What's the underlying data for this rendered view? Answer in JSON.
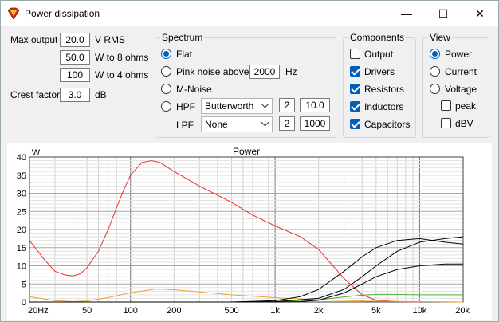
{
  "window": {
    "title": "Power dissipation",
    "buttons": {
      "minimize": "—",
      "maximize": "☐",
      "close": "✕"
    }
  },
  "levels": {
    "max_output_label": "Max output",
    "max_output_value": "20.0",
    "max_output_unit": "V  RMS",
    "w8_value": "50.0",
    "w8_unit": "W to 8 ohms",
    "w4_value": "100",
    "w4_unit": "W to 4 ohms",
    "crest_label": "Crest factor",
    "crest_value": "3.0",
    "crest_unit": "dB"
  },
  "spectrum": {
    "title": "Spectrum",
    "flat": "Flat",
    "pink": "Pink noise above",
    "pink_value": "2000",
    "pink_unit": "Hz",
    "mnoise": "M-Noise",
    "hpf": "HPF",
    "hpf_type": "Butterworth",
    "hpf_order": "2",
    "hpf_freq": "10.0",
    "lpf": "LPF",
    "lpf_type": "None",
    "lpf_order": "2",
    "lpf_freq": "1000",
    "selected": "flat"
  },
  "components": {
    "title": "Components",
    "items": [
      {
        "label": "Output",
        "checked": false
      },
      {
        "label": "Drivers",
        "checked": true
      },
      {
        "label": "Resistors",
        "checked": true
      },
      {
        "label": "Inductors",
        "checked": true
      },
      {
        "label": "Capacitors",
        "checked": true
      }
    ]
  },
  "view": {
    "title": "View",
    "power": "Power",
    "current": "Current",
    "voltage": "Voltage",
    "peak": "peak",
    "dbv": "dBV",
    "selected": "power"
  },
  "chart_data": {
    "type": "line",
    "title": "Power",
    "ylabel": "W",
    "xscale": "log",
    "xlim": [
      20,
      20000
    ],
    "ylim": [
      0,
      40
    ],
    "yticks": [
      0,
      5,
      10,
      15,
      20,
      25,
      30,
      35,
      40
    ],
    "xticks": [
      {
        "v": 20,
        "label": "20Hz"
      },
      {
        "v": 50,
        "label": "50"
      },
      {
        "v": 100,
        "label": "100"
      },
      {
        "v": 200,
        "label": "200"
      },
      {
        "v": 500,
        "label": "500"
      },
      {
        "v": 1000,
        "label": "1k"
      },
      {
        "v": 2000,
        "label": "2k"
      },
      {
        "v": 5000,
        "label": "5k"
      },
      {
        "v": 10000,
        "label": "10k"
      },
      {
        "v": 20000,
        "label": "20k"
      }
    ],
    "grid": true,
    "series": [
      {
        "color": "#e83030",
        "x": [
          20,
          25,
          30,
          35,
          40,
          45,
          50,
          60,
          70,
          80,
          90,
          100,
          120,
          140,
          160,
          200,
          300,
          500,
          700,
          1000,
          1500,
          2000,
          3000,
          4000,
          5000,
          7000,
          10000
        ],
        "y": [
          17,
          12,
          8.5,
          7.5,
          7.2,
          7.8,
          9.5,
          14,
          20,
          26,
          31,
          35,
          38.5,
          39,
          38.5,
          36,
          32,
          27.5,
          24,
          21,
          18,
          14.5,
          6.5,
          2,
          0.5,
          0.1,
          0
        ]
      },
      {
        "color": "#f0a030",
        "x": [
          20,
          30,
          40,
          50,
          70,
          100,
          150,
          200,
          300,
          500,
          1000,
          2000,
          5000,
          10000,
          20000
        ],
        "y": [
          1.5,
          0.4,
          0.1,
          0.3,
          1.2,
          2.6,
          3.6,
          3.4,
          2.8,
          2.0,
          1.2,
          0.6,
          0.2,
          0.1,
          0
        ]
      },
      {
        "color": "#50b030",
        "x": [
          20,
          500,
          1000,
          2000,
          3000,
          4000,
          5000,
          7000,
          10000,
          20000
        ],
        "y": [
          0,
          0,
          0.1,
          0.6,
          1.4,
          1.9,
          2.1,
          2.1,
          2.0,
          2.0
        ]
      },
      {
        "color": "#000000",
        "x": [
          20,
          500,
          1000,
          1500,
          2000,
          3000,
          4000,
          5000,
          7000,
          10000,
          15000,
          20000
        ],
        "y": [
          0,
          0,
          0.4,
          1.5,
          3.5,
          8.5,
          12.5,
          15,
          17,
          17.5,
          16.5,
          16
        ]
      },
      {
        "color": "#000000",
        "x": [
          20,
          500,
          1000,
          2000,
          3000,
          4000,
          5000,
          7000,
          10000,
          15000,
          20000
        ],
        "y": [
          0,
          0,
          0.1,
          1.0,
          3.5,
          7,
          10,
          14,
          16.5,
          17.5,
          18
        ]
      },
      {
        "color": "#000000",
        "x": [
          20,
          1000,
          1500,
          2000,
          3000,
          4000,
          5000,
          7000,
          10000,
          15000,
          20000
        ],
        "y": [
          0,
          0,
          0.1,
          0.5,
          2.5,
          5,
          7,
          9,
          10,
          10.5,
          10.5
        ]
      }
    ]
  }
}
